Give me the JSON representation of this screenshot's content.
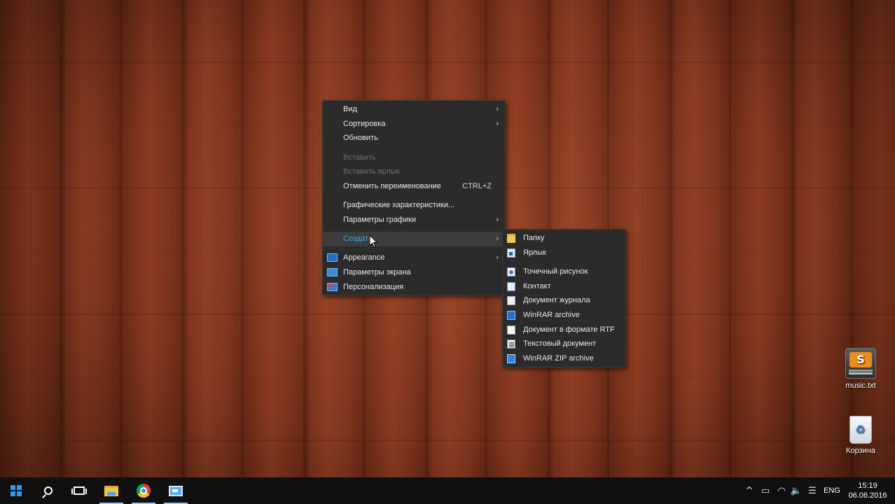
{
  "context_menu": {
    "items": [
      {
        "label": "Вид",
        "arrow": true
      },
      {
        "label": "Сортировка",
        "arrow": true
      },
      {
        "label": "Обновить"
      },
      {
        "label": "Вставить",
        "disabled": true
      },
      {
        "label": "Вставить ярлык",
        "disabled": true
      },
      {
        "label": "Отменить переименование",
        "shortcut": "CTRL+Z"
      },
      {
        "label": "Графические характеристики..."
      },
      {
        "label": "Параметры графики",
        "arrow": true
      },
      {
        "label": "Создать",
        "arrow": true,
        "active": true
      },
      {
        "label": "Appearance",
        "arrow": true,
        "icon": "monitor-icon"
      },
      {
        "label": "Параметры экрана",
        "icon": "display-settings-icon"
      },
      {
        "label": "Персонализация",
        "icon": "personalization-icon"
      }
    ],
    "arrow_glyph": "›"
  },
  "submenu": {
    "items": [
      {
        "label": "Папку",
        "icon": "folder-icon"
      },
      {
        "label": "Ярлык",
        "icon": "shortcut-icon"
      },
      {
        "label": "Точечный рисунок",
        "icon": "bitmap-icon"
      },
      {
        "label": "Контакт",
        "icon": "contact-icon"
      },
      {
        "label": "Документ журнала",
        "icon": "journal-icon"
      },
      {
        "label": "WinRAR archive",
        "icon": "winrar-icon"
      },
      {
        "label": "Документ в формате RTF",
        "icon": "rtf-icon"
      },
      {
        "label": "Текстовый документ",
        "icon": "text-document-icon"
      },
      {
        "label": "WinRAR ZIP archive",
        "icon": "winrar-zip-icon"
      }
    ]
  },
  "desktop": {
    "icons": [
      {
        "label": "music.txt",
        "icon": "sublime-text-icon",
        "glyph": "S"
      },
      {
        "label": "Корзина",
        "icon": "recycle-bin-icon",
        "glyph": "♻"
      }
    ]
  },
  "taskbar": {
    "buttons": [
      "start-button",
      "search-button",
      "task-view-button",
      "file-explorer-button",
      "chrome-button",
      "display-app-button"
    ],
    "tray": {
      "chevron": "^",
      "battery_glyph": "▭",
      "wifi_glyph": "◠",
      "volume_glyph": "🔈",
      "notification_glyph": "☰",
      "language": "ENG",
      "time": "15:19",
      "date": "06.06.2016"
    }
  },
  "colors": {
    "menu_bg": "#2b2b2b",
    "menu_text": "#e8e8e8",
    "menu_disabled": "#6d6d6d",
    "menu_active_text": "#3ba6e0",
    "taskbar_bg": "#101010"
  }
}
